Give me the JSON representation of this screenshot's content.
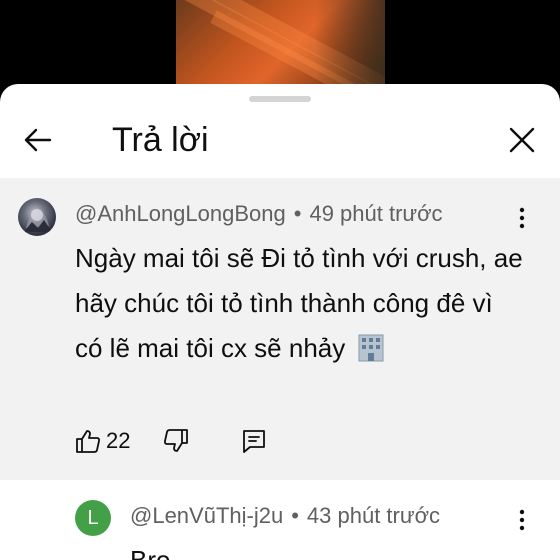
{
  "header": {
    "title": "Trả lời"
  },
  "parent_comment": {
    "author": "@AnhLongLongBong",
    "separator": "•",
    "time": "49 phút trước",
    "text": "Ngày mai tôi sẽ Đi tỏ tình với crush, ae hãy chúc tôi tỏ tình thành công đê vì có lẽ mai tôi cx sẽ nhảy",
    "emoji": "office-building",
    "like_count": "22"
  },
  "reply": {
    "avatar_letter": "L",
    "avatar_color": "#43a047",
    "author": "@LenVũThị-j2u",
    "separator": "•",
    "time": "43 phút trước",
    "text": "Bro"
  }
}
